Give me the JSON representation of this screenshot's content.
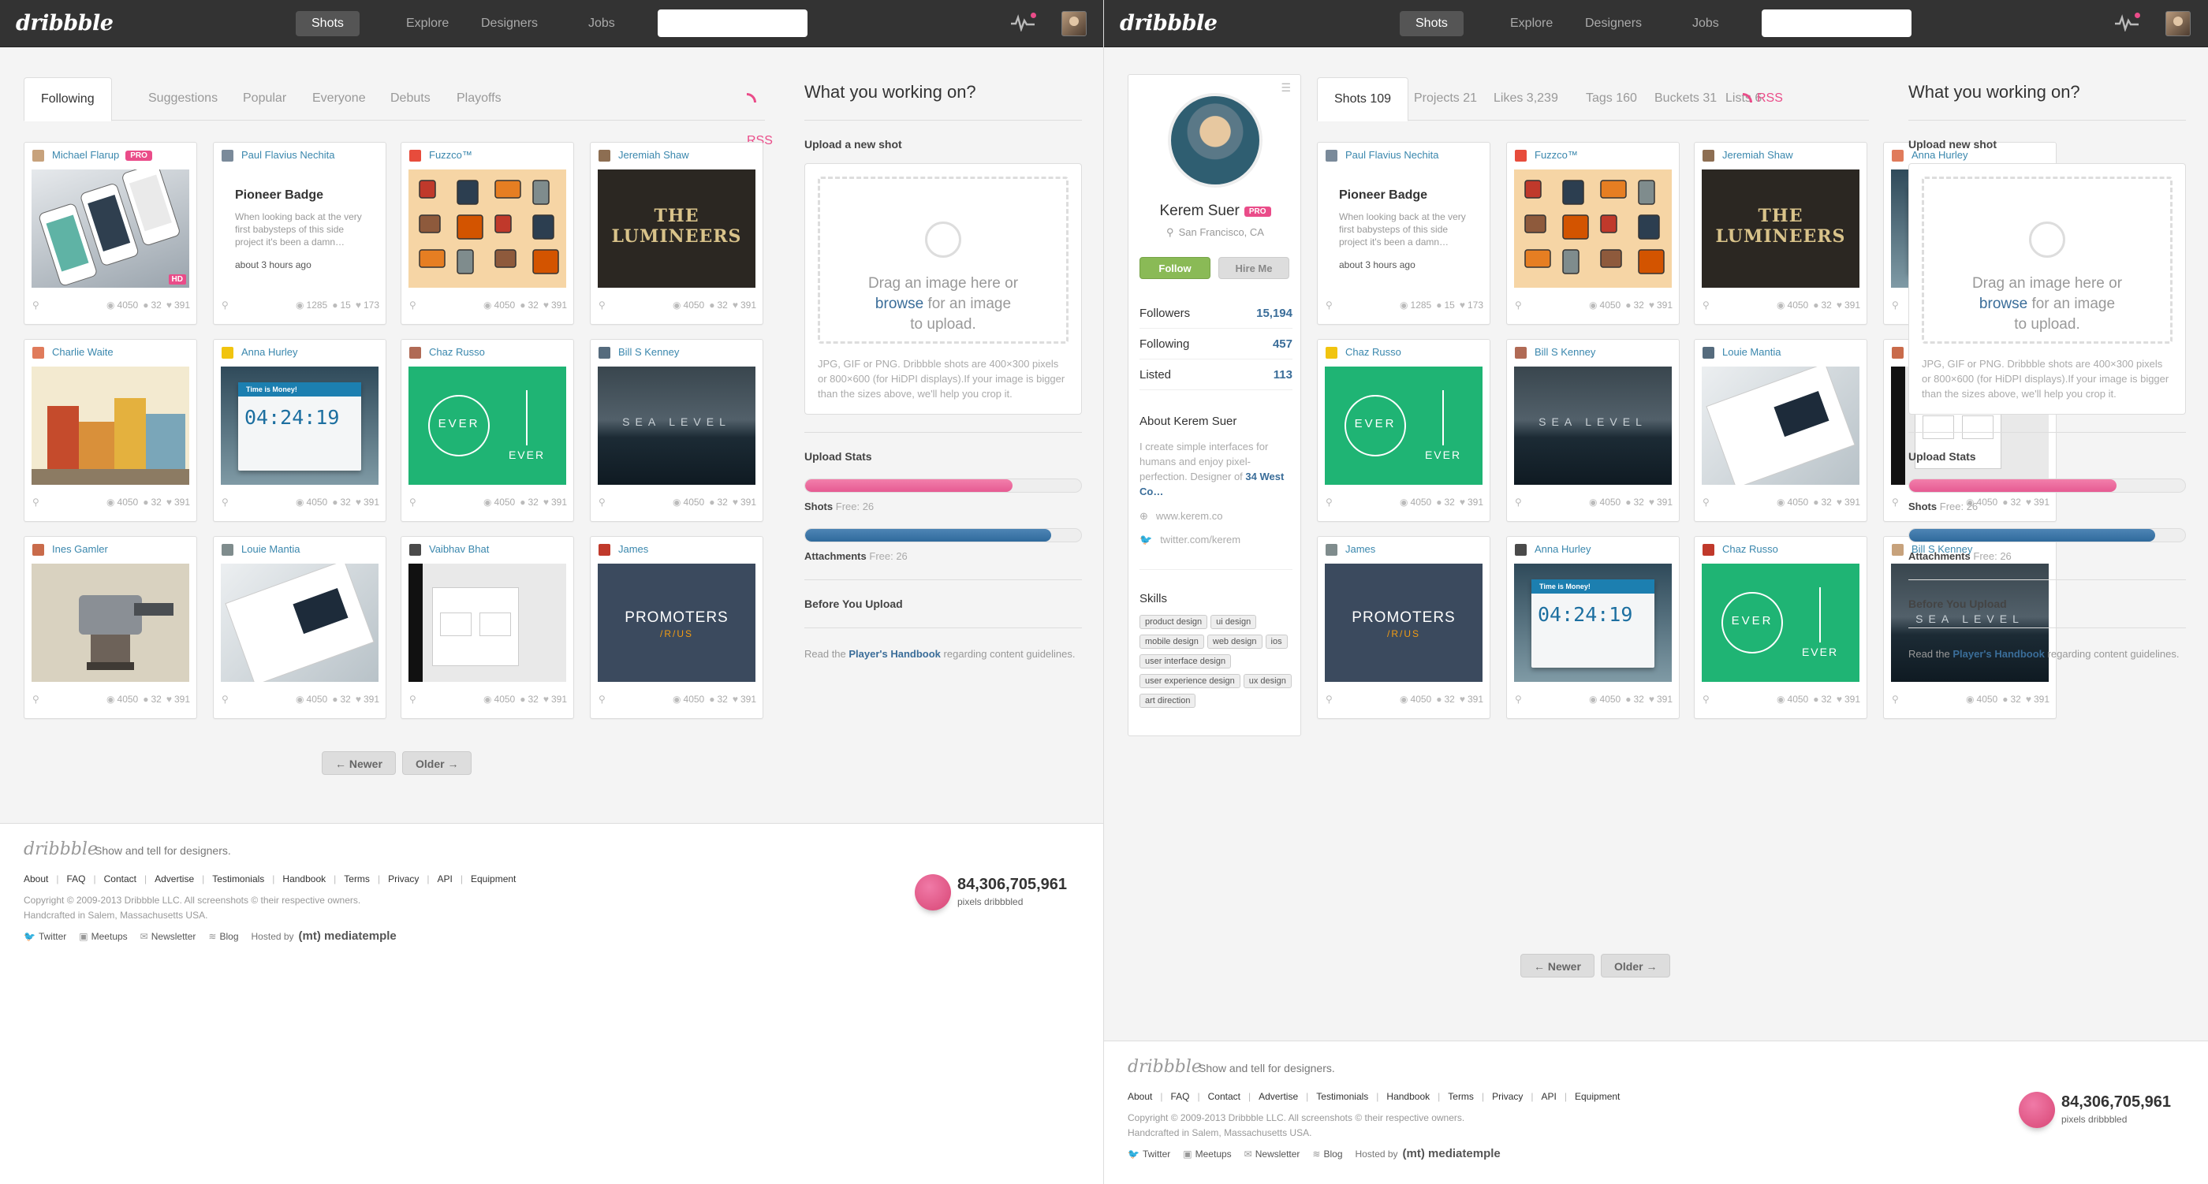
{
  "brand": "dribbble",
  "nav": [
    "Shots",
    "Explore",
    "Designers",
    "Jobs"
  ],
  "left": {
    "tabs": [
      "Following",
      "Suggestions",
      "Popular",
      "Everyone",
      "Debuts",
      "Playoffs"
    ],
    "rss": "RSS",
    "shots": [
      {
        "user": "Michael Flarup",
        "pro": "PRO",
        "hd": "HD",
        "views": "4050",
        "comments": "32",
        "likes": "391"
      },
      {
        "user": "Paul Flavius Nechita",
        "badge_title": "Pioneer Badge",
        "badge_desc": "When looking back at the very first babysteps of this side project it's been a damn…",
        "badge_ago": "about 3 hours ago",
        "views": "1285",
        "comments": "15",
        "likes": "173"
      },
      {
        "user": "Fuzzco™",
        "views": "4050",
        "comments": "32",
        "likes": "391"
      },
      {
        "user": "Jeremiah Shaw",
        "thumb_text": "THE LUMINEERS",
        "views": "4050",
        "comments": "32",
        "likes": "391"
      },
      {
        "user": "Charlie Waite",
        "views": "4050",
        "comments": "32",
        "likes": "391"
      },
      {
        "user": "Anna Hurley",
        "timer_label": "Time is Money!",
        "timer": "04:24:19",
        "views": "4050",
        "comments": "32",
        "likes": "391"
      },
      {
        "user": "Chaz Russo",
        "thumb_text": "EVER",
        "views": "4050",
        "comments": "32",
        "likes": "391"
      },
      {
        "user": "Bill S Kenney",
        "thumb_text": "SEA LEVEL",
        "views": "4050",
        "comments": "32",
        "likes": "391"
      },
      {
        "user": "Ines Gamler",
        "views": "4050",
        "comments": "32",
        "likes": "391"
      },
      {
        "user": "Louie Mantia",
        "views": "4050",
        "comments": "32",
        "likes": "391"
      },
      {
        "user": "Vaibhav Bhat",
        "views": "4050",
        "comments": "32",
        "likes": "391"
      },
      {
        "user": "James",
        "thumb_text": "PROMOTERS",
        "thumb_sub": "/R/US",
        "views": "4050",
        "comments": "32",
        "likes": "391"
      }
    ],
    "pager": {
      "newer": "← Newer",
      "older": "Older →"
    },
    "side": {
      "title": "What you working on?",
      "upload_label": "Upload a new shot",
      "drop_a": "Drag an image here or",
      "drop_link": "browse",
      "drop_b": "for an image",
      "drop_c": "to upload.",
      "note": "JPG, GIF or PNG. Dribbble shots are 400×300 pixels or 800×600 (for HiDPI displays).If your image is bigger than the sizes above, we'll help you crop it.",
      "stats_title": "Upload Stats",
      "shots_label": "Shots",
      "shots_free": "Free: 26",
      "shots_fill": 0.75,
      "att_label": "Attachments",
      "att_free": "Free: 26",
      "att_fill": 0.89,
      "before_title": "Before You Upload",
      "hb_a": "Read the",
      "hb_link": "Player's Handbook",
      "hb_b": "regarding content guidelines."
    }
  },
  "right": {
    "tabs": [
      "Shots 109",
      "Projects 21",
      "Likes 3,239",
      "Tags 160",
      "Buckets 31",
      "Lists 6"
    ],
    "rss": "RSS",
    "profile": {
      "name": "Kerem Suer",
      "pro": "PRO",
      "location": "San Francisco, CA",
      "follow": "Follow",
      "hire": "Hire Me",
      "stats": [
        {
          "label": "Followers",
          "value": "15,194"
        },
        {
          "label": "Following",
          "value": "457"
        },
        {
          "label": "Listed",
          "value": "113"
        }
      ],
      "about_title": "About Kerem Suer",
      "bio": "I create simple interfaces for humans and enjoy pixel-perfection. Designer of",
      "bio_link": "34 West Co…",
      "site": "www.kerem.co",
      "twitter": "twitter.com/kerem",
      "skills_title": "Skills",
      "skills": [
        "product design",
        "ui design",
        "mobile design",
        "web design",
        "ios",
        "user interface design",
        "user experience design",
        "ux design",
        "art direction"
      ]
    },
    "shots": [
      {
        "user": "Paul Flavius Nechita",
        "badge_title": "Pioneer Badge",
        "badge_desc": "When looking back at the very first babysteps of this side project it's been a damn…",
        "badge_ago": "about 3 hours ago",
        "views": "1285",
        "comments": "15",
        "likes": "173"
      },
      {
        "user": "Fuzzco™",
        "views": "4050",
        "comments": "32",
        "likes": "391"
      },
      {
        "user": "Jeremiah Shaw",
        "thumb_text": "THE LUMINEERS",
        "views": "4050",
        "comments": "32",
        "likes": "391"
      },
      {
        "user": "Anna Hurley",
        "timer_label": "Time is Money!",
        "timer": "04:24:19",
        "views": "4050",
        "comments": "32",
        "likes": "391"
      },
      {
        "user": "Chaz Russo",
        "thumb_text": "EVER",
        "views": "4050",
        "comments": "32",
        "likes": "391"
      },
      {
        "user": "Bill S Kenney",
        "thumb_text": "SEA LEVEL",
        "views": "4050",
        "comments": "32",
        "likes": "391"
      },
      {
        "user": "Louie Mantia",
        "views": "4050",
        "comments": "32",
        "likes": "391"
      },
      {
        "user": "Vaibhav Bhat",
        "views": "4050",
        "comments": "32",
        "likes": "391"
      },
      {
        "user": "James",
        "thumb_text": "PROMOTERS",
        "thumb_sub": "/R/US",
        "views": "4050",
        "comments": "32",
        "likes": "391"
      },
      {
        "user": "Anna Hurley",
        "timer_label": "Time is Money!",
        "timer": "04:24:19",
        "views": "4050",
        "comments": "32",
        "likes": "391"
      },
      {
        "user": "Chaz Russo",
        "thumb_text": "EVER",
        "views": "4050",
        "comments": "32",
        "likes": "391"
      },
      {
        "user": "Bill S Kenney",
        "thumb_text": "SEA LEVEL",
        "views": "4050",
        "comments": "32",
        "likes": "391"
      }
    ],
    "side_upload_label": "Upload new shot"
  },
  "footer": {
    "logo": "dribbble",
    "tagline": "Show and tell for designers.",
    "links": [
      "About",
      "FAQ",
      "Contact",
      "Advertise",
      "Testimonials",
      "Handbook",
      "Terms",
      "Privacy",
      "API",
      "Equipment"
    ],
    "copyright": "Copyright © 2009-2013 Dribbble LLC. All screenshots © their respective owners.",
    "handcrafted": "Handcrafted in Salem, Massachusetts USA.",
    "social": [
      "Twitter",
      "Meetups",
      "Newsletter",
      "Blog"
    ],
    "hosted": "Hosted by",
    "host": "(mt) mediatemple",
    "pixels": "84,306,705,961",
    "pixels_label": "pixels dribbbled"
  },
  "colors": {
    "accent": "#ea4c89",
    "link": "#3a87ad",
    "green": "#8aba56",
    "blue": "#3a6d99"
  }
}
